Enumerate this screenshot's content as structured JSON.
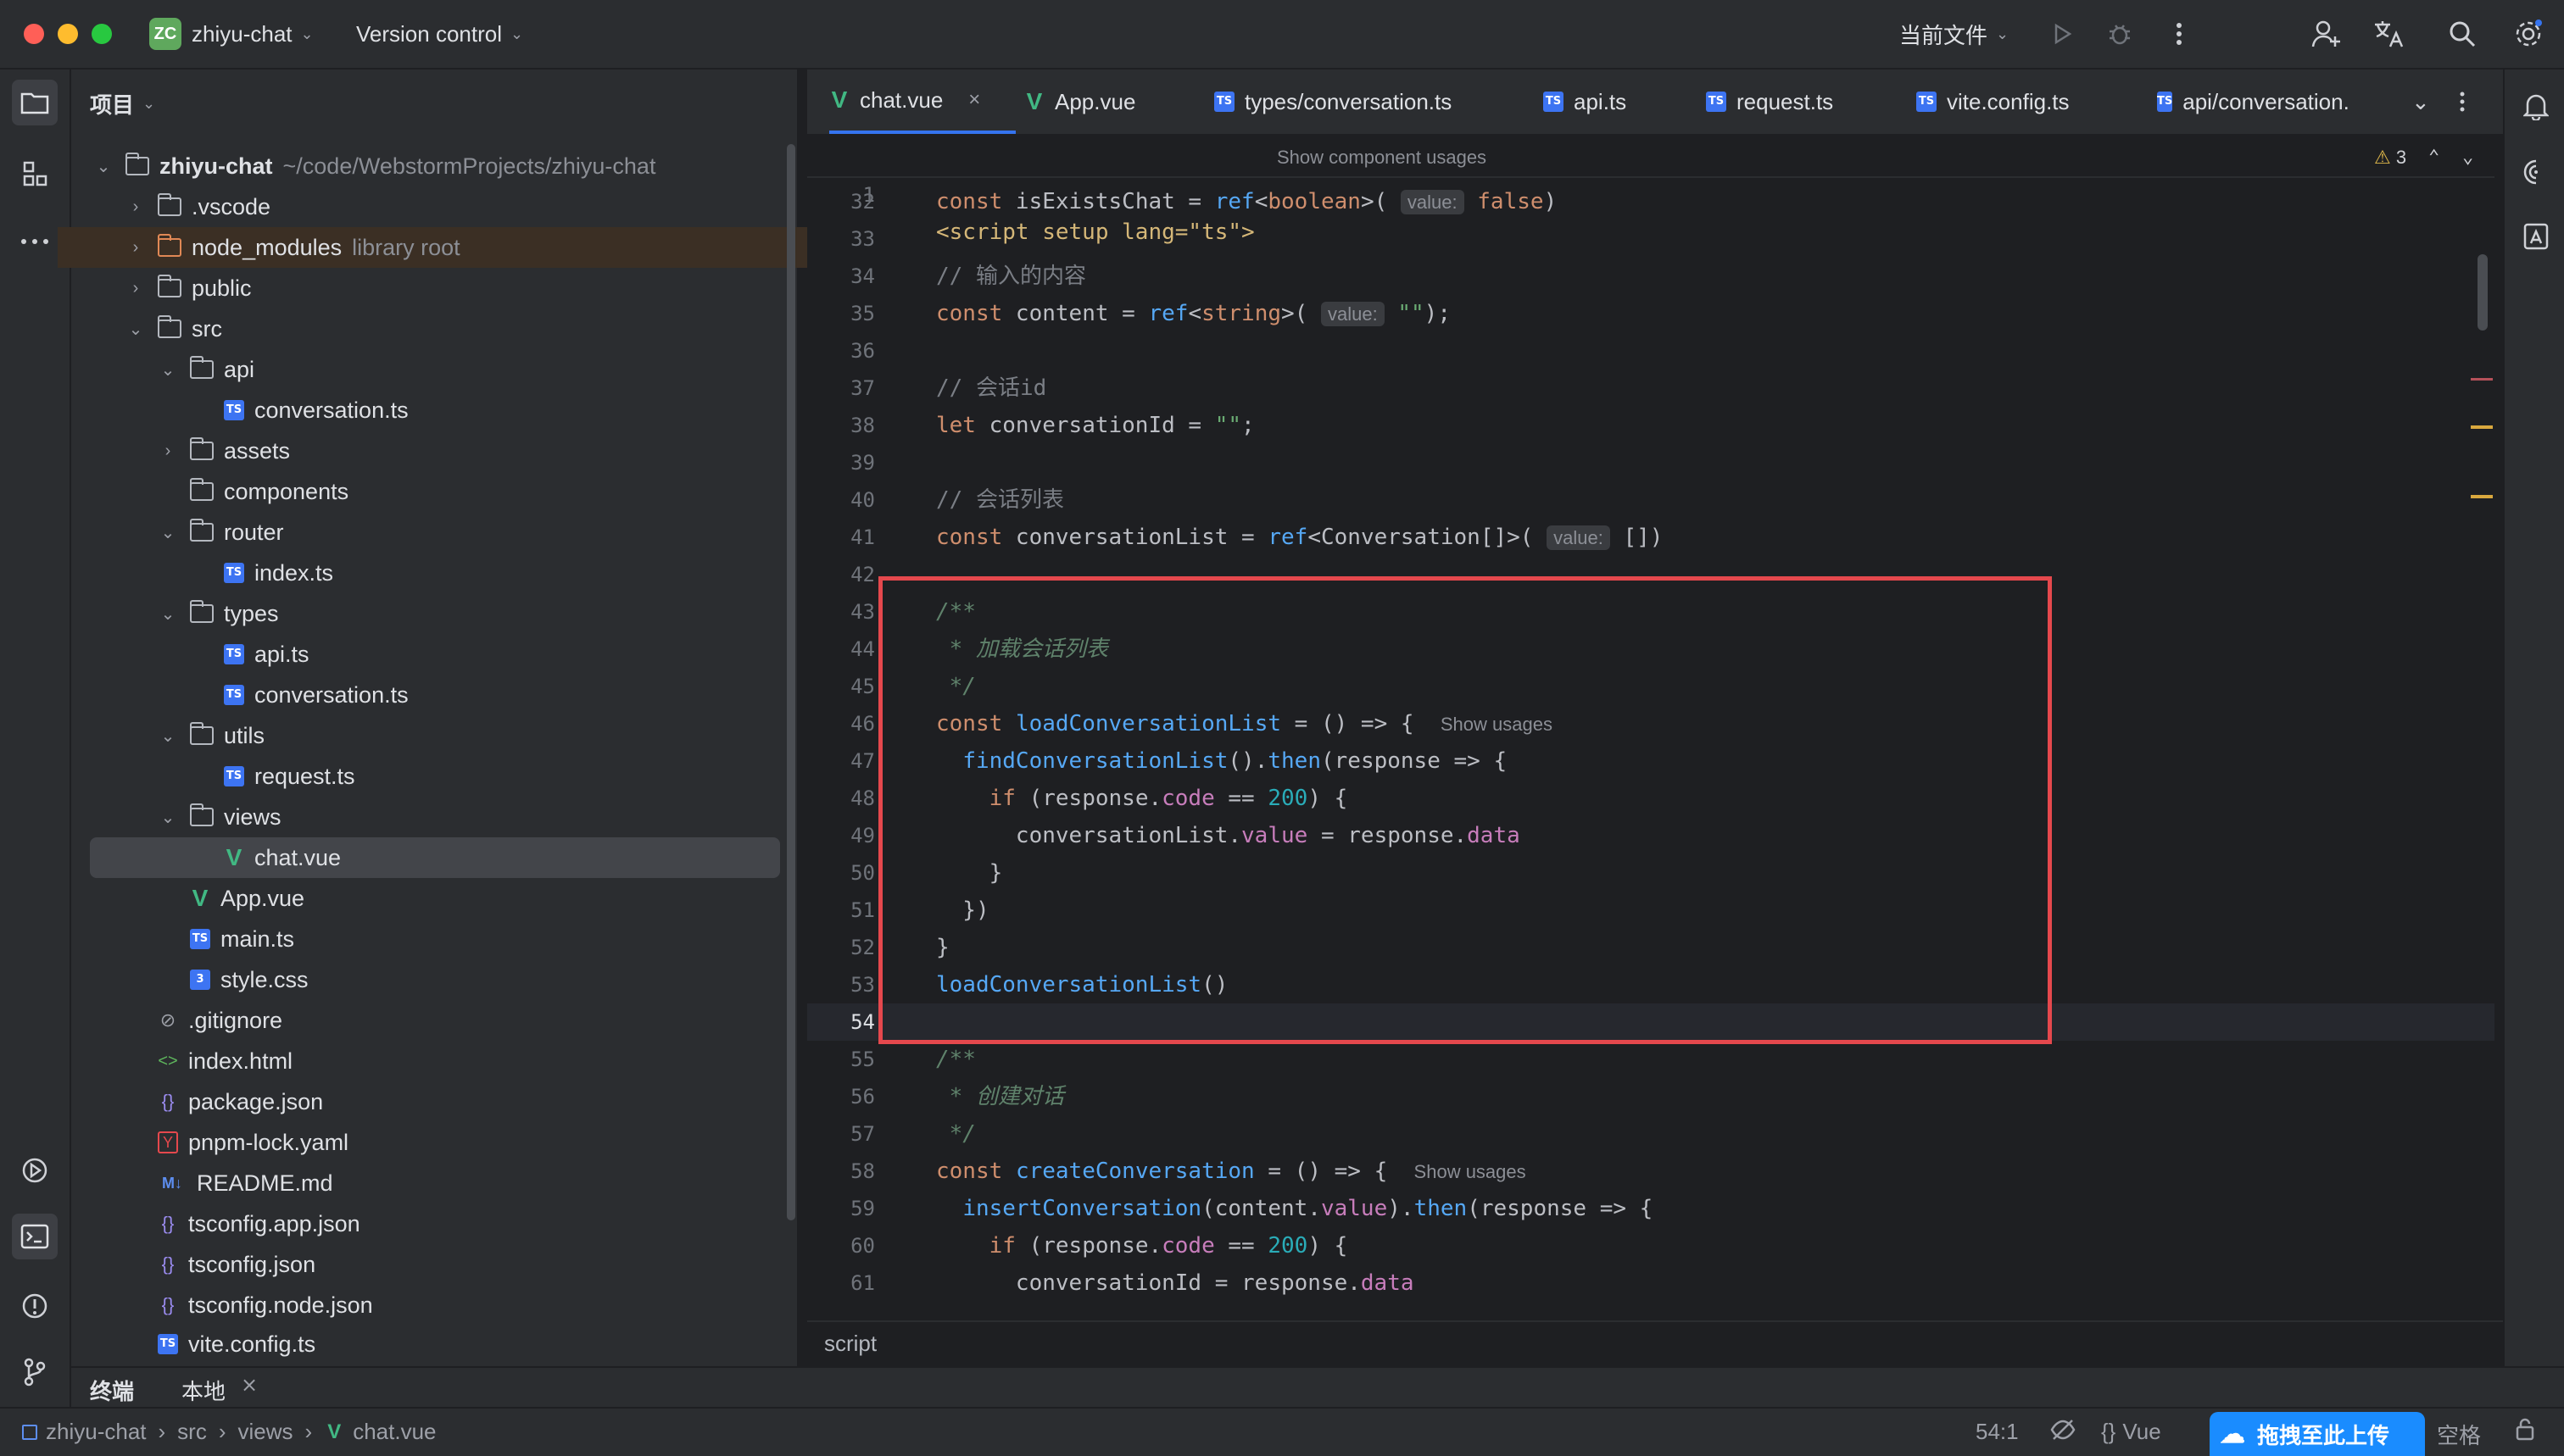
{
  "titlebar": {
    "project_badge": "ZC",
    "project_name": "zhiyu-chat",
    "vcs": "Version control",
    "run_config": "当前文件"
  },
  "project_panel": {
    "title": "项目",
    "root": {
      "name": "zhiyu-chat",
      "path": "~/code/WebstormProjects/zhiyu-chat"
    },
    "items": [
      {
        "name": ".vscode"
      },
      {
        "name": "node_modules",
        "note": "library root"
      },
      {
        "name": "public"
      },
      {
        "name": "src"
      },
      {
        "name": "api"
      },
      {
        "name": "conversation.ts"
      },
      {
        "name": "assets"
      },
      {
        "name": "components"
      },
      {
        "name": "router"
      },
      {
        "name": "index.ts"
      },
      {
        "name": "types"
      },
      {
        "name": "api.ts"
      },
      {
        "name": "conversation.ts"
      },
      {
        "name": "utils"
      },
      {
        "name": "request.ts"
      },
      {
        "name": "views"
      },
      {
        "name": "chat.vue"
      },
      {
        "name": "App.vue"
      },
      {
        "name": "main.ts"
      },
      {
        "name": "style.css"
      },
      {
        "name": ".gitignore"
      },
      {
        "name": "index.html"
      },
      {
        "name": "package.json"
      },
      {
        "name": "pnpm-lock.yaml"
      },
      {
        "name": "README.md"
      },
      {
        "name": "tsconfig.app.json"
      },
      {
        "name": "tsconfig.json"
      },
      {
        "name": "tsconfig.node.json"
      },
      {
        "name": "vite.config.ts"
      }
    ]
  },
  "tabs": [
    {
      "label": "chat.vue",
      "icon": "vue-icon",
      "active": true
    },
    {
      "label": "App.vue",
      "icon": "vue-icon"
    },
    {
      "label": "types/conversation.ts",
      "icon": "ts-icon"
    },
    {
      "label": "api.ts",
      "icon": "ts-icon"
    },
    {
      "label": "request.ts",
      "icon": "ts-icon"
    },
    {
      "label": "vite.config.ts",
      "icon": "ts-icon"
    },
    {
      "label": "api/conversation.ts",
      "icon": "ts-icon"
    }
  ],
  "editor": {
    "sticky_line_no": "1",
    "sticky_code": "<script setup lang=\"ts\">",
    "sticky_hint": "Show component usages",
    "warnings": "3",
    "line_numbers": [
      "32",
      "33",
      "34",
      "35",
      "36",
      "37",
      "38",
      "39",
      "40",
      "41",
      "42",
      "43",
      "44",
      "45",
      "46",
      "47",
      "48",
      "49",
      "50",
      "51",
      "52",
      "53",
      "54",
      "55",
      "56",
      "57",
      "58",
      "59",
      "60",
      "61"
    ],
    "hint_value": "value:",
    "hint_show_usages": "Show usages",
    "breadcrumb": "script"
  },
  "bottom_tabs": {
    "terminal": "终端",
    "local": "本地"
  },
  "statusbar": {
    "path": [
      "zhiyu-chat",
      "src",
      "views",
      "chat.vue"
    ],
    "position": "54:1",
    "language": "Vue",
    "upload_label": "拖拽至此上传",
    "indent": "空格"
  },
  "colors": {
    "accent": "#3574f0",
    "highlight_box": "#e5484d",
    "vue_green": "#41b883"
  }
}
